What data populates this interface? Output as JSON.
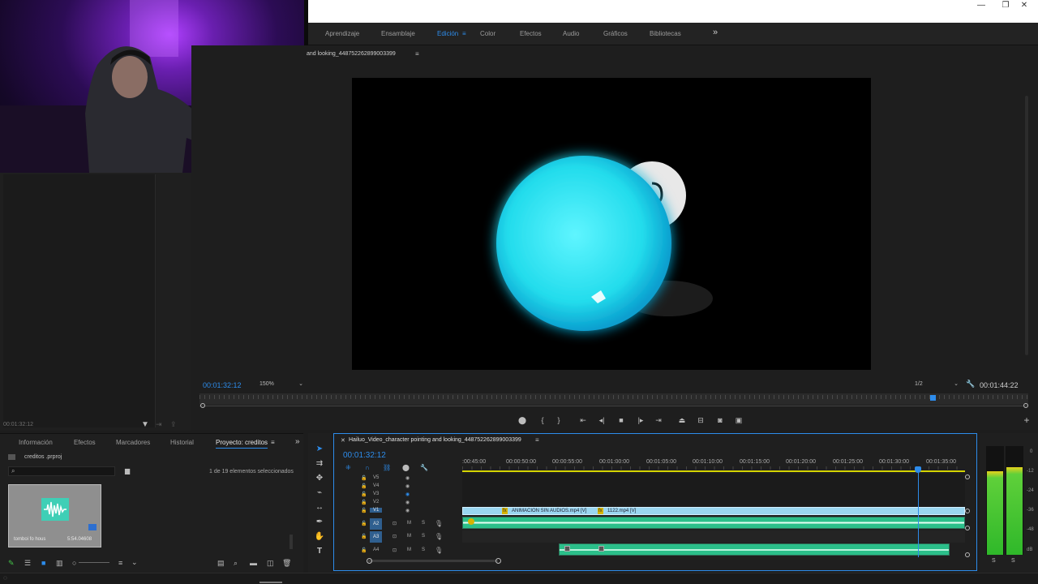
{
  "workspaces": {
    "items": [
      "Aprendizaje",
      "Ensamblaje",
      "Edición",
      "Color",
      "Efectos",
      "Audio",
      "Gráficos",
      "Bibliotecas"
    ],
    "active": "Edición",
    "more": "»"
  },
  "window_controls": [
    "—",
    "❐",
    "✕"
  ],
  "program_monitor": {
    "sequence_title": "and looking_448752262899003399",
    "current_timecode": "00:01:32:12",
    "zoom": "150%",
    "resolution": "1/2",
    "duration": "00:01:44:22",
    "playhead_fraction": 0.885
  },
  "source_panel": {
    "timecode": "00:01:32:12"
  },
  "project_panel": {
    "tabs": [
      "Información",
      "Efectos",
      "Marcadores",
      "Historial",
      "Proyecto: creditos"
    ],
    "active_tab": "Proyecto: creditos",
    "project_file": "creditos .prproj",
    "selection_status": "1 de 19 elementos seleccionados",
    "clip_name": "tomboi fo hous",
    "clip_duration": "5:54.04608"
  },
  "timeline": {
    "sequence_name": "Hailuo_Video_character pointing and looking_448752262899003399",
    "timecode": "00:01:32:12",
    "ruler": [
      ":00:45:00",
      "00:00:50:00",
      "00:00:55:00",
      "00:01:00:00",
      "00:01:05:00",
      "00:01:10:00",
      "00:01:15:00",
      "00:01:20:00",
      "00:01:25:00",
      "00:01:30:00",
      "00:01:35:00"
    ],
    "video_tracks": [
      "V5",
      "V4",
      "V3",
      "V2",
      "V1"
    ],
    "audio_tracks": [
      "A2",
      "A3",
      "A4"
    ],
    "track_buttons": {
      "mute": "M",
      "solo": "S"
    },
    "clips": {
      "v1_a": "ANIMACION SIN AUDIOS.mp4 [V]",
      "v1_b": "1122.mp4 [V]",
      "fx": "fx"
    }
  },
  "meters": {
    "scale": [
      "0",
      "-12",
      "-24",
      "-36",
      "-48",
      "dB"
    ],
    "left_level": 0.78,
    "right_level": 0.82,
    "solo_labels": [
      "S",
      "S"
    ]
  },
  "colors": {
    "accent": "#2d8ceb",
    "audio_green": "#2bbf8a",
    "video_clip": "#9ad6f0",
    "orb": "#27e3ee"
  },
  "icons": [
    "search-icon",
    "new-bin-icon",
    "play-icon",
    "stop-icon",
    "step-back-icon",
    "step-forward-icon",
    "go-to-in-icon",
    "go-to-out-icon",
    "camera-icon",
    "wrench-icon",
    "lock-icon",
    "eye-icon",
    "mic-icon",
    "selection-tool-icon",
    "razor-tool-icon",
    "hand-tool-icon",
    "type-tool-icon",
    "pen-tool-icon"
  ]
}
